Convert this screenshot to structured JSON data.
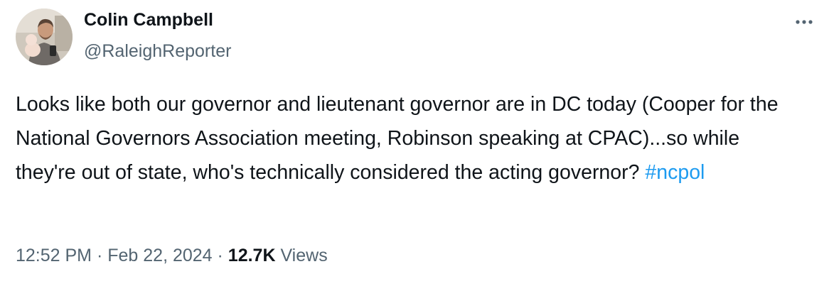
{
  "author": {
    "name": "Colin Campbell",
    "handle": "@RaleighReporter"
  },
  "tweet": {
    "text": "Looks like both our governor and lieutenant governor are in DC today (Cooper for the National Governors Association meeting, Robinson speaking at CPAC)...so while they're out of state, who's technically considered the acting governor? ",
    "hashtag": "#ncpol"
  },
  "meta": {
    "time": "12:52 PM",
    "separator": " · ",
    "date": "Feb 22, 2024",
    "views_count": "12.7K",
    "views_label": " Views"
  },
  "icons": {
    "more": "more-horizontal-icon"
  },
  "colors": {
    "text": "#0f1419",
    "secondary": "#536471",
    "link": "#1d9bf0"
  }
}
